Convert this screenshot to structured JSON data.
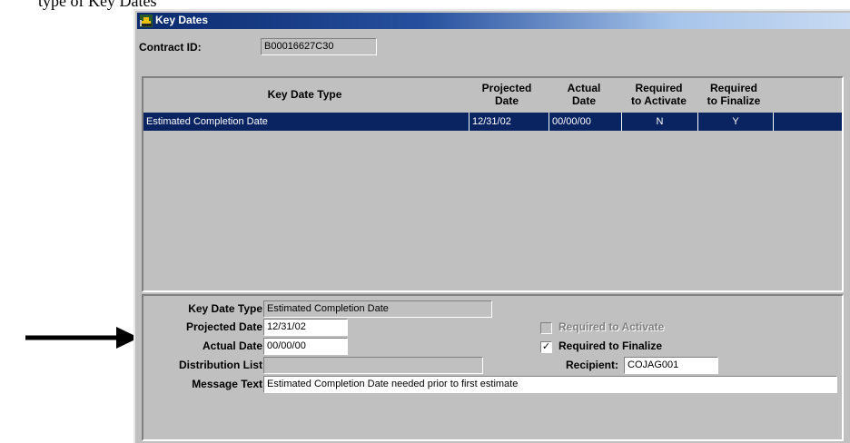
{
  "document_text": "type of Key Dates",
  "window": {
    "title": "Key Dates"
  },
  "contract": {
    "label": "Contract ID:",
    "value": "B00016627C30"
  },
  "grid": {
    "headers": {
      "key_date_type": "Key Date Type",
      "projected_1": "Projected",
      "projected_2": "Date",
      "actual_1": "Actual",
      "actual_2": "Date",
      "req_act_1": "Required",
      "req_act_2": "to Activate",
      "req_fin_1": "Required",
      "req_fin_2": "to Finalize"
    },
    "rows": [
      {
        "key_date_type": "Estimated Completion Date",
        "projected": "12/31/02",
        "actual": "00/00/00",
        "req_activate": "N",
        "req_finalize": "Y"
      }
    ]
  },
  "detail": {
    "key_date_type_label": "Key Date Type:",
    "key_date_type_value": "Estimated Completion Date",
    "projected_label": "Projected Date:",
    "projected_value": "12/31/02",
    "actual_label": "Actual Date:",
    "actual_value": "00/00/00",
    "distribution_label": "Distribution List:",
    "distribution_value": "",
    "req_activate_label": "Required to Activate",
    "req_activate_checked": false,
    "req_finalize_label": "Required to Finalize",
    "req_finalize_checked": true,
    "recipient_label": "Recipient:",
    "recipient_value": "COJAG001",
    "message_label": "Message Text:",
    "message_value": "Estimated Completion Date needed prior to first estimate"
  },
  "colors": {
    "selection": "#0a2462",
    "dialog": "#c0c0c0",
    "arrow": "#000000"
  },
  "icons": {
    "title": "bulldozer-icon",
    "pointer": "arrow-right-icon",
    "checkmark": "✓"
  }
}
